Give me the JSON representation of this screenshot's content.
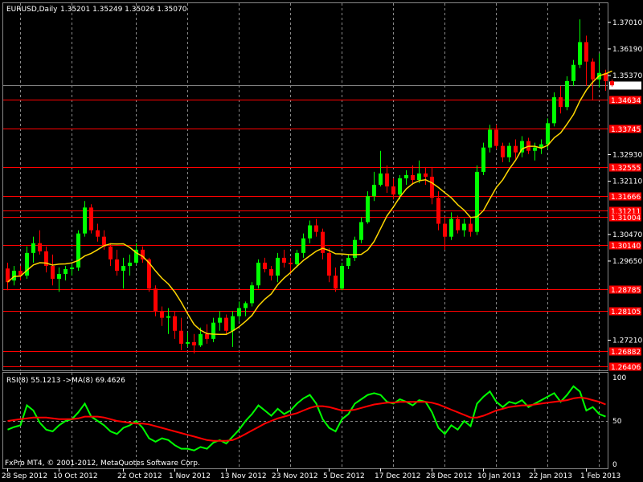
{
  "chart_data": [
    {
      "type": "candlestick",
      "symbol_label": "EURUSD,Daily",
      "ohlc_label": "1.35201 1.35249 1.35026 1.35070",
      "current_price_label": "1.35070",
      "current_price": 1.3507,
      "ylim": [
        1.2628,
        1.376
      ],
      "y_ticks": [
        {
          "v": 1.3701,
          "label": "1.37010"
        },
        {
          "v": 1.3619,
          "label": "1.36190"
        },
        {
          "v": 1.3537,
          "label": "1.35370"
        },
        {
          "v": 1.3293,
          "label": "1.32930"
        },
        {
          "v": 1.3211,
          "label": "1.32110"
        },
        {
          "v": 1.3047,
          "label": "1.30470"
        },
        {
          "v": 1.2965,
          "label": "1.29650"
        },
        {
          "v": 1.2721,
          "label": "1.27210"
        }
      ],
      "levels": [
        {
          "v": 1.34634,
          "label": "1.34634"
        },
        {
          "v": 1.33745,
          "label": "1.33745"
        },
        {
          "v": 1.32555,
          "label": "1.32555"
        },
        {
          "v": 1.31666,
          "label": "1.31666"
        },
        {
          "v": 1.31211,
          "label": "1.31211"
        },
        {
          "v": 1.31004,
          "label": "1.31004"
        },
        {
          "v": 1.3014,
          "label": "1.30140"
        },
        {
          "v": 1.28785,
          "label": "1.28785"
        },
        {
          "v": 1.28105,
          "label": "1.28105"
        },
        {
          "v": 1.26882,
          "label": "1.26882"
        },
        {
          "v": 1.26406,
          "label": "1.26406"
        }
      ],
      "x_labels": [
        {
          "i": 0,
          "label": "28 Sep 2012"
        },
        {
          "i": 8,
          "label": "10 Oct 2012"
        },
        {
          "i": 18,
          "label": "22 Oct 2012"
        },
        {
          "i": 26,
          "label": "1 Nov 2012"
        },
        {
          "i": 34,
          "label": "13 Nov 2012"
        },
        {
          "i": 42,
          "label": "23 Nov 2012"
        },
        {
          "i": 50,
          "label": "5 Dec 2012"
        },
        {
          "i": 58,
          "label": "17 Dec 2012"
        },
        {
          "i": 66,
          "label": "28 Dec 2012"
        },
        {
          "i": 74,
          "label": "10 Jan 2013"
        },
        {
          "i": 82,
          "label": "22 Jan 2013"
        },
        {
          "i": 90,
          "label": "1 Feb 2013"
        }
      ],
      "grid_dividers": [
        2,
        10,
        20,
        28,
        36,
        44,
        52,
        60,
        68,
        76,
        84,
        92
      ],
      "candles": [
        {
          "o": 1.2942,
          "h": 1.296,
          "l": 1.2875,
          "c": 1.29
        },
        {
          "o": 1.2905,
          "h": 1.295,
          "l": 1.289,
          "c": 1.2935
        },
        {
          "o": 1.2935,
          "h": 1.295,
          "l": 1.2905,
          "c": 1.292
        },
        {
          "o": 1.292,
          "h": 1.301,
          "l": 1.291,
          "c": 1.299
        },
        {
          "o": 1.299,
          "h": 1.304,
          "l": 1.296,
          "c": 1.302
        },
        {
          "o": 1.302,
          "h": 1.306,
          "l": 1.2985,
          "c": 1.2995
        },
        {
          "o": 1.2995,
          "h": 1.301,
          "l": 1.293,
          "c": 1.295
        },
        {
          "o": 1.295,
          "h": 1.2985,
          "l": 1.289,
          "c": 1.291
        },
        {
          "o": 1.291,
          "h": 1.2945,
          "l": 1.287,
          "c": 1.2925
        },
        {
          "o": 1.2925,
          "h": 1.295,
          "l": 1.2905,
          "c": 1.294
        },
        {
          "o": 1.294,
          "h": 1.2955,
          "l": 1.292,
          "c": 1.2945
        },
        {
          "o": 1.2945,
          "h": 1.306,
          "l": 1.2935,
          "c": 1.305
        },
        {
          "o": 1.305,
          "h": 1.315,
          "l": 1.304,
          "c": 1.313
        },
        {
          "o": 1.313,
          "h": 1.314,
          "l": 1.305,
          "c": 1.306
        },
        {
          "o": 1.306,
          "h": 1.308,
          "l": 1.3025,
          "c": 1.304
        },
        {
          "o": 1.304,
          "h": 1.306,
          "l": 1.3,
          "c": 1.301
        },
        {
          "o": 1.301,
          "h": 1.302,
          "l": 1.295,
          "c": 1.297
        },
        {
          "o": 1.297,
          "h": 1.3,
          "l": 1.292,
          "c": 1.2935
        },
        {
          "o": 1.2935,
          "h": 1.2975,
          "l": 1.288,
          "c": 1.295
        },
        {
          "o": 1.295,
          "h": 1.2985,
          "l": 1.292,
          "c": 1.296
        },
        {
          "o": 1.296,
          "h": 1.302,
          "l": 1.2955,
          "c": 1.3
        },
        {
          "o": 1.3,
          "h": 1.301,
          "l": 1.296,
          "c": 1.297
        },
        {
          "o": 1.297,
          "h": 1.2975,
          "l": 1.287,
          "c": 1.288
        },
        {
          "o": 1.288,
          "h": 1.289,
          "l": 1.2795,
          "c": 1.281
        },
        {
          "o": 1.281,
          "h": 1.2825,
          "l": 1.2765,
          "c": 1.279
        },
        {
          "o": 1.279,
          "h": 1.282,
          "l": 1.274,
          "c": 1.2795
        },
        {
          "o": 1.2795,
          "h": 1.281,
          "l": 1.2725,
          "c": 1.275
        },
        {
          "o": 1.275,
          "h": 1.279,
          "l": 1.269,
          "c": 1.271
        },
        {
          "o": 1.271,
          "h": 1.2745,
          "l": 1.27,
          "c": 1.2715
        },
        {
          "o": 1.2715,
          "h": 1.274,
          "l": 1.268,
          "c": 1.2705
        },
        {
          "o": 1.2705,
          "h": 1.276,
          "l": 1.27,
          "c": 1.274
        },
        {
          "o": 1.274,
          "h": 1.277,
          "l": 1.271,
          "c": 1.2725
        },
        {
          "o": 1.2725,
          "h": 1.279,
          "l": 1.2715,
          "c": 1.2775
        },
        {
          "o": 1.2775,
          "h": 1.281,
          "l": 1.275,
          "c": 1.279
        },
        {
          "o": 1.279,
          "h": 1.28,
          "l": 1.274,
          "c": 1.275
        },
        {
          "o": 1.275,
          "h": 1.281,
          "l": 1.27,
          "c": 1.2795
        },
        {
          "o": 1.2795,
          "h": 1.284,
          "l": 1.278,
          "c": 1.282
        },
        {
          "o": 1.282,
          "h": 1.284,
          "l": 1.2795,
          "c": 1.2835
        },
        {
          "o": 1.2835,
          "h": 1.29,
          "l": 1.2825,
          "c": 1.289
        },
        {
          "o": 1.289,
          "h": 1.297,
          "l": 1.288,
          "c": 1.296
        },
        {
          "o": 1.296,
          "h": 1.2975,
          "l": 1.293,
          "c": 1.294
        },
        {
          "o": 1.294,
          "h": 1.295,
          "l": 1.2905,
          "c": 1.292
        },
        {
          "o": 1.292,
          "h": 1.299,
          "l": 1.29,
          "c": 1.2975
        },
        {
          "o": 1.2975,
          "h": 1.3,
          "l": 1.2945,
          "c": 1.296
        },
        {
          "o": 1.296,
          "h": 1.2975,
          "l": 1.2925,
          "c": 1.2955
        },
        {
          "o": 1.2955,
          "h": 1.3,
          "l": 1.2945,
          "c": 1.299
        },
        {
          "o": 1.299,
          "h": 1.305,
          "l": 1.2975,
          "c": 1.3035
        },
        {
          "o": 1.3035,
          "h": 1.309,
          "l": 1.302,
          "c": 1.3075
        },
        {
          "o": 1.3075,
          "h": 1.3095,
          "l": 1.304,
          "c": 1.3055
        },
        {
          "o": 1.3055,
          "h": 1.3065,
          "l": 1.297,
          "c": 1.299
        },
        {
          "o": 1.299,
          "h": 1.3005,
          "l": 1.29,
          "c": 1.292
        },
        {
          "o": 1.292,
          "h": 1.2945,
          "l": 1.287,
          "c": 1.288
        },
        {
          "o": 1.288,
          "h": 1.296,
          "l": 1.2875,
          "c": 1.295
        },
        {
          "o": 1.295,
          "h": 1.2985,
          "l": 1.294,
          "c": 1.2975
        },
        {
          "o": 1.2975,
          "h": 1.304,
          "l": 1.2965,
          "c": 1.303
        },
        {
          "o": 1.303,
          "h": 1.31,
          "l": 1.302,
          "c": 1.3085
        },
        {
          "o": 1.3085,
          "h": 1.318,
          "l": 1.308,
          "c": 1.3165
        },
        {
          "o": 1.3165,
          "h": 1.324,
          "l": 1.315,
          "c": 1.32
        },
        {
          "o": 1.32,
          "h": 1.3305,
          "l": 1.3195,
          "c": 1.3235
        },
        {
          "o": 1.3235,
          "h": 1.326,
          "l": 1.3175,
          "c": 1.3195
        },
        {
          "o": 1.3195,
          "h": 1.322,
          "l": 1.3155,
          "c": 1.317
        },
        {
          "o": 1.317,
          "h": 1.323,
          "l": 1.3155,
          "c": 1.322
        },
        {
          "o": 1.322,
          "h": 1.3245,
          "l": 1.32,
          "c": 1.323
        },
        {
          "o": 1.323,
          "h": 1.326,
          "l": 1.32,
          "c": 1.3215
        },
        {
          "o": 1.3215,
          "h": 1.3275,
          "l": 1.3205,
          "c": 1.3235
        },
        {
          "o": 1.3235,
          "h": 1.3255,
          "l": 1.32,
          "c": 1.3225
        },
        {
          "o": 1.3225,
          "h": 1.3255,
          "l": 1.314,
          "c": 1.316
        },
        {
          "o": 1.316,
          "h": 1.318,
          "l": 1.306,
          "c": 1.308
        },
        {
          "o": 1.308,
          "h": 1.31,
          "l": 1.3,
          "c": 1.304
        },
        {
          "o": 1.304,
          "h": 1.3115,
          "l": 1.303,
          "c": 1.3095
        },
        {
          "o": 1.3095,
          "h": 1.3105,
          "l": 1.305,
          "c": 1.306
        },
        {
          "o": 1.306,
          "h": 1.3095,
          "l": 1.304,
          "c": 1.308
        },
        {
          "o": 1.308,
          "h": 1.31,
          "l": 1.304,
          "c": 1.3055
        },
        {
          "o": 1.3055,
          "h": 1.326,
          "l": 1.3045,
          "c": 1.324
        },
        {
          "o": 1.324,
          "h": 1.333,
          "l": 1.323,
          "c": 1.3315
        },
        {
          "o": 1.3315,
          "h": 1.3385,
          "l": 1.33,
          "c": 1.337
        },
        {
          "o": 1.337,
          "h": 1.3385,
          "l": 1.331,
          "c": 1.332
        },
        {
          "o": 1.332,
          "h": 1.333,
          "l": 1.327,
          "c": 1.3285
        },
        {
          "o": 1.3285,
          "h": 1.333,
          "l": 1.327,
          "c": 1.332
        },
        {
          "o": 1.332,
          "h": 1.334,
          "l": 1.328,
          "c": 1.33
        },
        {
          "o": 1.33,
          "h": 1.335,
          "l": 1.3285,
          "c": 1.3335
        },
        {
          "o": 1.3335,
          "h": 1.3345,
          "l": 1.3295,
          "c": 1.3305
        },
        {
          "o": 1.3305,
          "h": 1.333,
          "l": 1.3275,
          "c": 1.3315
        },
        {
          "o": 1.3315,
          "h": 1.334,
          "l": 1.3295,
          "c": 1.3325
        },
        {
          "o": 1.3325,
          "h": 1.3405,
          "l": 1.331,
          "c": 1.339
        },
        {
          "o": 1.339,
          "h": 1.3485,
          "l": 1.338,
          "c": 1.347
        },
        {
          "o": 1.347,
          "h": 1.3505,
          "l": 1.342,
          "c": 1.344
        },
        {
          "o": 1.344,
          "h": 1.3535,
          "l": 1.343,
          "c": 1.352
        },
        {
          "o": 1.352,
          "h": 1.3585,
          "l": 1.3505,
          "c": 1.357
        },
        {
          "o": 1.357,
          "h": 1.371,
          "l": 1.356,
          "c": 1.364
        },
        {
          "o": 1.364,
          "h": 1.366,
          "l": 1.3505,
          "c": 1.358
        },
        {
          "o": 1.358,
          "h": 1.359,
          "l": 1.346,
          "c": 1.3525
        },
        {
          "o": 1.3525,
          "h": 1.3605,
          "l": 1.35,
          "c": 1.3545
        },
        {
          "o": 1.3545,
          "h": 1.3555,
          "l": 1.349,
          "c": 1.352
        },
        {
          "o": 1.352,
          "h": 1.3525,
          "l": 1.3503,
          "c": 1.3507
        }
      ],
      "colors": {
        "bull": "#00ff00",
        "bear": "#ff0000",
        "ma": "#ffd700",
        "grid": "#888888",
        "level": "#ff0000",
        "current": "#808080"
      }
    },
    {
      "type": "line",
      "label": "RSI(8) 55.1213  ->MA(8) 69.4626",
      "ylim": [
        0,
        100
      ],
      "y_ticks": [
        {
          "v": 100,
          "label": "100"
        },
        {
          "v": 50,
          "label": "50"
        },
        {
          "v": 0,
          "label": "0"
        }
      ],
      "level_line": 50,
      "series": [
        {
          "color": "#00ff00",
          "values": [
            40,
            43,
            45,
            68,
            62,
            48,
            40,
            38,
            45,
            50,
            52,
            60,
            70,
            55,
            50,
            45,
            38,
            35,
            42,
            45,
            50,
            42,
            30,
            26,
            30,
            28,
            22,
            18,
            18,
            16,
            20,
            18,
            25,
            28,
            24,
            32,
            40,
            50,
            58,
            68,
            62,
            56,
            64,
            58,
            62,
            70,
            76,
            80,
            70,
            52,
            42,
            38,
            52,
            58,
            70,
            75,
            80,
            82,
            80,
            72,
            70,
            75,
            72,
            68,
            74,
            72,
            60,
            42,
            35,
            45,
            40,
            50,
            44,
            70,
            78,
            84,
            72,
            66,
            72,
            70,
            74,
            66,
            70,
            74,
            78,
            82,
            72,
            80,
            90,
            84,
            62,
            66,
            58,
            55
          ]
        },
        {
          "color": "#ff0000",
          "values": [
            50,
            51,
            52,
            53,
            54,
            54,
            54,
            53,
            52,
            52,
            52,
            53,
            55,
            55,
            55,
            54,
            52,
            50,
            49,
            48,
            47,
            47,
            46,
            44,
            42,
            40,
            38,
            36,
            34,
            32,
            30,
            28,
            27,
            27,
            27,
            28,
            31,
            35,
            39,
            43,
            47,
            50,
            53,
            55,
            57,
            59,
            62,
            65,
            67,
            67,
            66,
            64,
            62,
            62,
            63,
            65,
            67,
            69,
            70,
            71,
            71,
            72,
            72,
            72,
            72,
            72,
            71,
            69,
            66,
            63,
            60,
            57,
            54,
            54,
            56,
            59,
            62,
            64,
            66,
            67,
            68,
            68,
            69,
            70,
            71,
            72,
            73,
            74,
            76,
            77,
            76,
            74,
            72,
            69
          ]
        }
      ],
      "colors": {
        "grid": "#888888"
      }
    }
  ],
  "footer": {
    "copyright": "FxPro MT4, © 2001-2012, MetaQuotes Software Corp."
  }
}
